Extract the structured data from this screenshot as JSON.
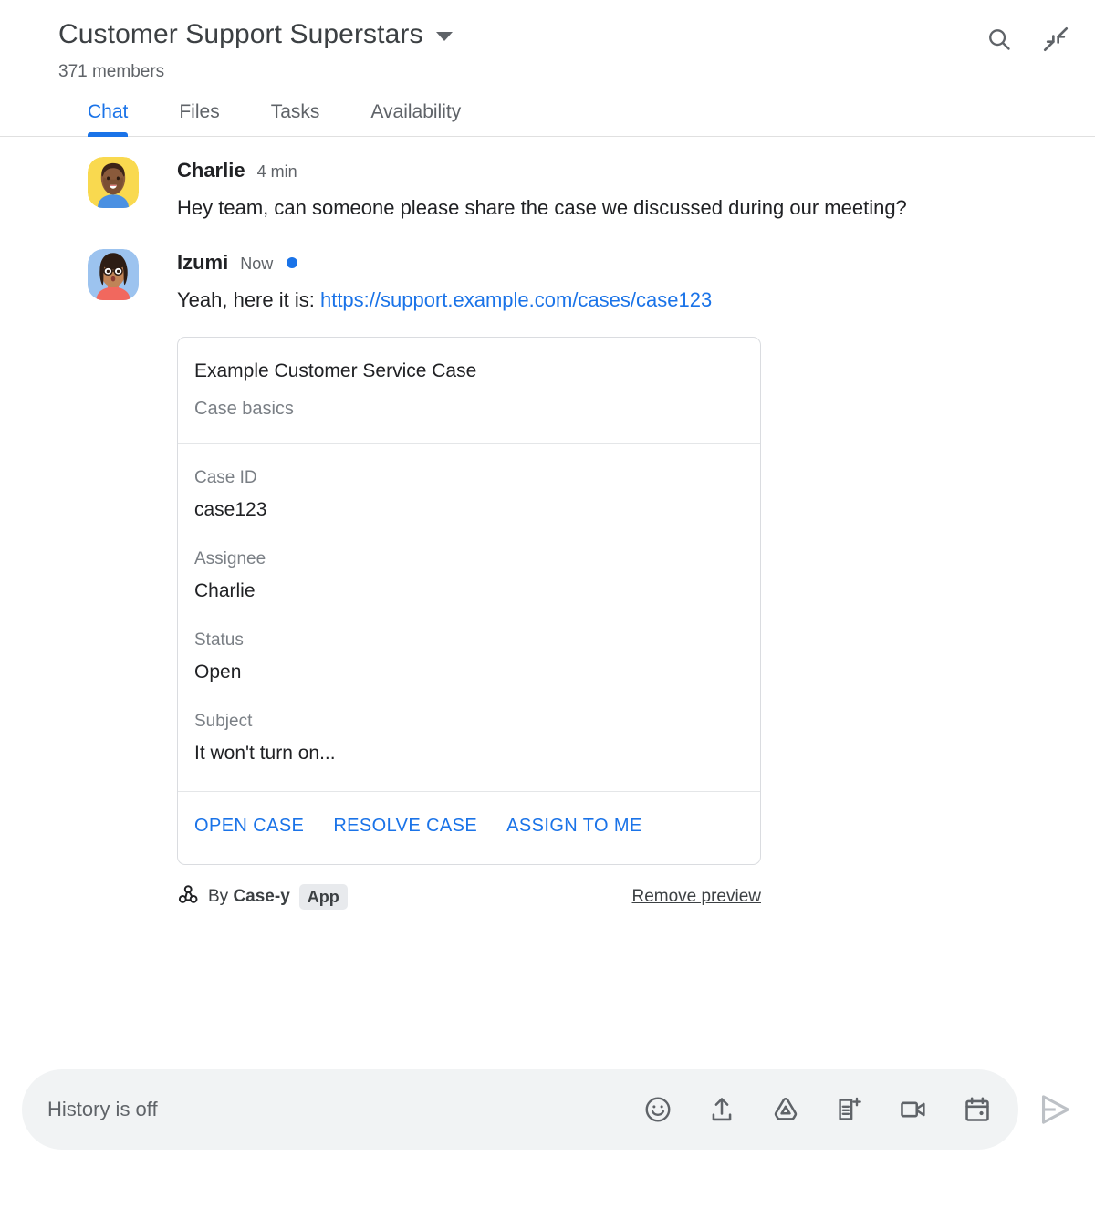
{
  "header": {
    "title": "Customer Support Superstars",
    "members": "371 members",
    "dropdown_icon": "chevron-down-icon",
    "search_icon": "search-icon",
    "collapse_icon": "collapse-icon"
  },
  "tabs": [
    {
      "label": "Chat",
      "active": true
    },
    {
      "label": "Files",
      "active": false
    },
    {
      "label": "Tasks",
      "active": false
    },
    {
      "label": "Availability",
      "active": false
    }
  ],
  "messages": [
    {
      "sender": "Charlie",
      "timestamp": "4 min",
      "unread": false,
      "text": "Hey team, can someone please share the case we discussed during our meeting?"
    },
    {
      "sender": "Izumi",
      "timestamp": "Now",
      "unread": true,
      "text_prefix": "Yeah, here it is: ",
      "link_text": "https://support.example.com/cases/case123"
    }
  ],
  "card": {
    "title": "Example Customer Service Case",
    "subtitle": "Case basics",
    "fields": [
      {
        "label": "Case ID",
        "value": "case123"
      },
      {
        "label": "Assignee",
        "value": "Charlie"
      },
      {
        "label": "Status",
        "value": "Open"
      },
      {
        "label": "Subject",
        "value": "It won't turn on..."
      }
    ],
    "actions": [
      "OPEN CASE",
      "RESOLVE CASE",
      "ASSIGN TO ME"
    ]
  },
  "attribution": {
    "icon": "webhook-icon",
    "by_text": "By ",
    "app_name": "Case-y",
    "badge": "App",
    "remove_preview": "Remove preview"
  },
  "composer": {
    "placeholder": "History is off",
    "icons": [
      "emoji-icon",
      "upload-icon",
      "google-drive-icon",
      "new-document-icon",
      "video-camera-icon",
      "calendar-icon"
    ],
    "send_icon": "send-icon"
  },
  "colors": {
    "accent": "#1a73e8",
    "text_primary": "#202124",
    "text_secondary": "#5f6368",
    "border": "#dadce0",
    "composer_bg": "#f1f3f4",
    "send_disabled": "#bdc1c6"
  }
}
